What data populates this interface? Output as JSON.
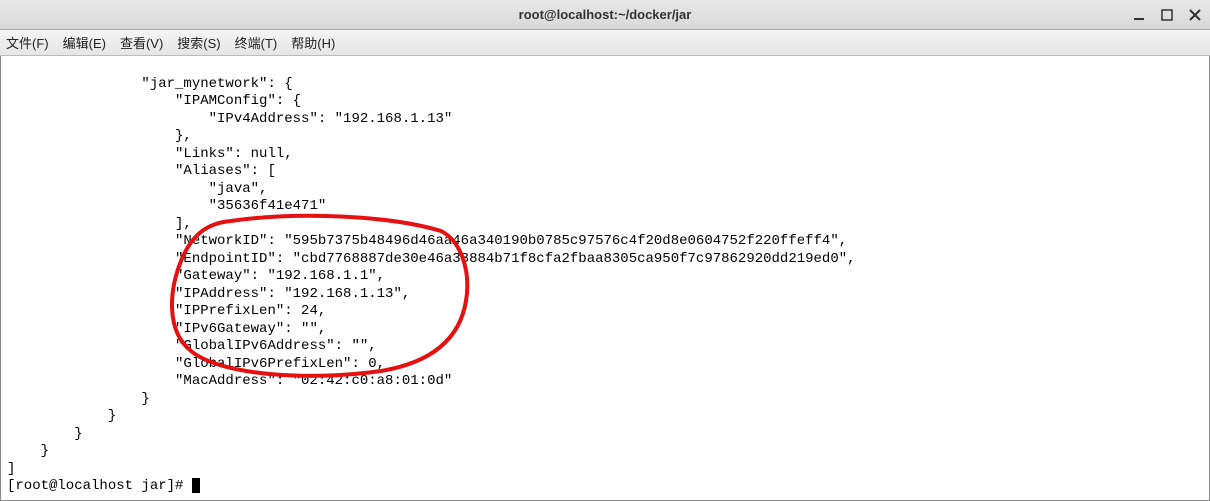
{
  "titlebar": {
    "title": "root@localhost:~/docker/jar"
  },
  "menubar": {
    "file": "文件(F)",
    "edit": "编辑(E)",
    "view": "查看(V)",
    "search": "搜索(S)",
    "terminal": "终端(T)",
    "help": "帮助(H)"
  },
  "terminal": {
    "output_lines": [
      "                \"jar_mynetwork\": {",
      "                    \"IPAMConfig\": {",
      "                        \"IPv4Address\": \"192.168.1.13\"",
      "                    },",
      "                    \"Links\": null,",
      "                    \"Aliases\": [",
      "                        \"java\",",
      "                        \"35636f41e471\"",
      "                    ],",
      "                    \"NetworkID\": \"595b7375b48496d46aa46a340190b0785c97576c4f20d8e0604752f220ffeff4\",",
      "                    \"EndpointID\": \"cbd7768887de30e46a33884b71f8cfa2fbaa8305ca950f7c97862920dd219ed0\",",
      "                    \"Gateway\": \"192.168.1.1\",",
      "                    \"IPAddress\": \"192.168.1.13\",",
      "                    \"IPPrefixLen\": 24,",
      "                    \"IPv6Gateway\": \"\",",
      "                    \"GlobalIPv6Address\": \"\",",
      "                    \"GlobalIPv6PrefixLen\": 0,",
      "                    \"MacAddress\": \"02:42:c0:a8:01:0d\"",
      "                }",
      "            }",
      "        }",
      "    }",
      "]"
    ],
    "prompt": "[root@localhost jar]# "
  }
}
